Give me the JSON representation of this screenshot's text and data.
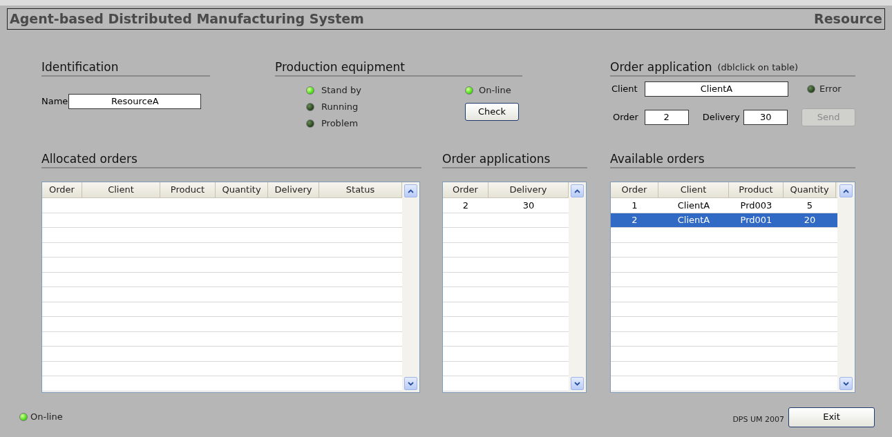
{
  "window": {
    "title": "Agent-based Distributed Manufacturing System",
    "role": "Resource"
  },
  "identification": {
    "heading": "Identification",
    "name_label": "Name",
    "name_value": "ResourceA"
  },
  "production_equipment": {
    "heading": "Production equipment",
    "lamps": [
      {
        "label": "Stand by",
        "on": true
      },
      {
        "label": "Running",
        "on": false
      },
      {
        "label": "Problem",
        "on": false
      }
    ],
    "online": {
      "label": "On-line",
      "on": true
    },
    "check_button": "Check"
  },
  "order_application": {
    "heading": "Order application",
    "hint": "(dblclick on table)",
    "client_label": "Client",
    "client_value": "ClientA",
    "error": {
      "label": "Error",
      "on": false
    },
    "order_label": "Order",
    "order_value": "2",
    "delivery_label": "Delivery",
    "delivery_value": "30",
    "send_button": {
      "label": "Send",
      "disabled": true
    }
  },
  "tables": [
    {
      "heading": "Allocated orders",
      "columns": [
        "Order",
        "Client",
        "Product",
        "Quantity",
        "Delivery",
        "Status"
      ]
    },
    {
      "heading": "Order applications",
      "columns": [
        "Order",
        "Delivery"
      ],
      "rows": [
        {
          "cells": [
            "2",
            "30"
          ],
          "selected": false
        }
      ]
    },
    {
      "heading": "Available orders",
      "columns": [
        "Order",
        "Client",
        "Product",
        "Quantity"
      ],
      "rows": [
        {
          "cells": [
            "1",
            "ClientA",
            "Prd003",
            "5"
          ],
          "selected": false
        },
        {
          "cells": [
            "2",
            "ClientA",
            "Prd001",
            "20"
          ],
          "selected": true
        }
      ]
    }
  ],
  "status_bar": {
    "online": {
      "label": "On-line",
      "on": true
    },
    "credit": "DPS UM 2007",
    "exit_button": "Exit"
  }
}
